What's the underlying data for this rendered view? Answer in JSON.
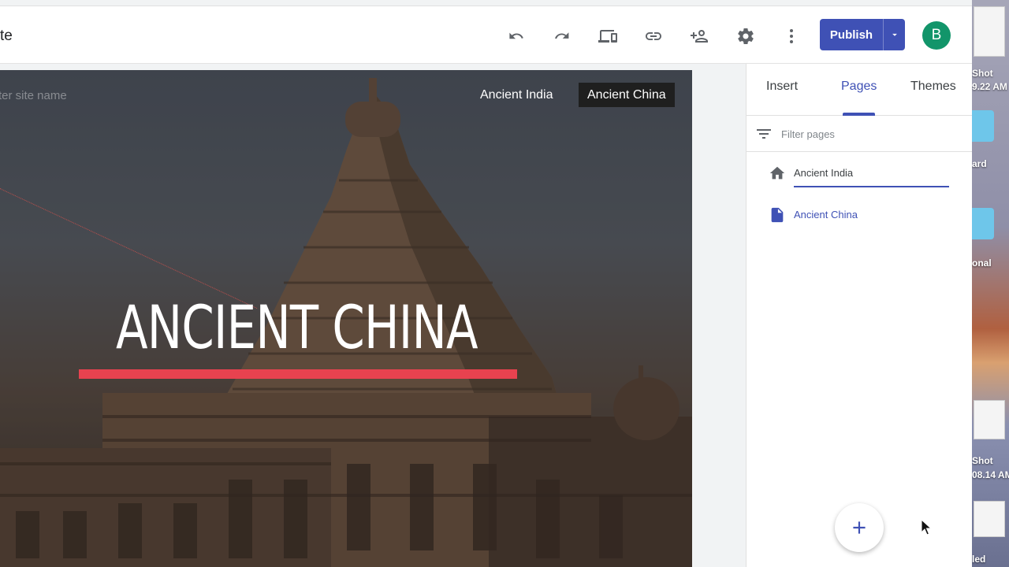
{
  "toolbar": {
    "doc_title": "te",
    "publish_label": "Publish",
    "avatar_letter": "B",
    "icons": [
      "undo-icon",
      "redo-icon",
      "preview-devices-icon",
      "link-icon",
      "share-person-add-icon",
      "settings-gear-icon",
      "more-vert-icon"
    ]
  },
  "hero": {
    "site_name_placeholder": "ter site name",
    "nav": [
      {
        "label": "Ancient India",
        "active": false
      },
      {
        "label": "Ancient China",
        "active": true
      }
    ],
    "title": "ANCIENT CHINA",
    "accent_color": "#e8424f"
  },
  "panel": {
    "tabs": [
      {
        "label": "Insert",
        "active": false
      },
      {
        "label": "Pages",
        "active": true
      },
      {
        "label": "Themes",
        "active": false
      }
    ],
    "filter_placeholder": "Filter pages",
    "pages": [
      {
        "label": "Ancient India",
        "icon": "home-icon",
        "editing": true
      },
      {
        "label": "Ancient China",
        "icon": "page-icon",
        "editing": false
      }
    ],
    "accent_color": "#3f51b5"
  },
  "desktop": {
    "labels": [
      "Shot",
      "9.22 AM",
      "ard",
      "onal",
      "Shot",
      "08.14 AM",
      "led"
    ]
  }
}
